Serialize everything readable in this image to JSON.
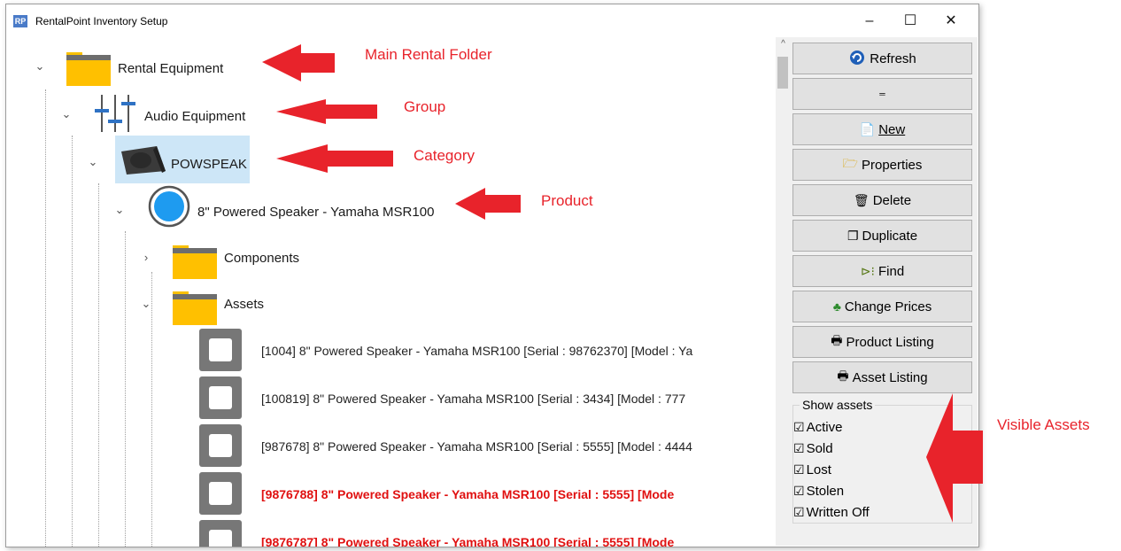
{
  "window": {
    "app_icon": "RP",
    "title": "RentalPoint Inventory Setup",
    "controls": {
      "minimize": "–",
      "maximize": "☐",
      "close": "✕"
    }
  },
  "tree": {
    "rental_equipment": "Rental Equipment",
    "audio_equipment": "Audio Equipment",
    "powspeak": "POWSPEAK",
    "product": "8\" Powered Speaker - Yamaha MSR100",
    "components": "Components",
    "assets": "Assets",
    "asset_rows": [
      {
        "text": "[1004] 8\" Powered Speaker - Yamaha MSR100    [Serial : 98762370]   [Model : Ya",
        "red": false
      },
      {
        "text": "[100819] 8\" Powered Speaker - Yamaha MSR100    [Serial : 3434]   [Model : 777",
        "red": false
      },
      {
        "text": "[987678] 8\" Powered Speaker - Yamaha MSR100    [Serial : 5555]   [Model : 4444",
        "red": false
      },
      {
        "text": "[9876788] 8\" Powered Speaker - Yamaha MSR100    [Serial : 5555]    [Mode",
        "red": true
      },
      {
        "text": "[9876787] 8\" Powered Speaker - Yamaha MSR100    [Serial : 5555]    [Mode",
        "red": true
      }
    ]
  },
  "buttons": {
    "refresh": "Refresh",
    "collapse": "═",
    "new": "New",
    "properties": "Properties",
    "delete": "Delete",
    "duplicate": "Duplicate",
    "find": "Find",
    "change_prices": "Change Prices",
    "product_listing": "Product Listing",
    "asset_listing": "Asset Listing"
  },
  "show_assets": {
    "title": "Show assets",
    "options": [
      {
        "label": "Active",
        "checked": true
      },
      {
        "label": "Sold",
        "checked": true
      },
      {
        "label": "Lost",
        "checked": true
      },
      {
        "label": "Stolen",
        "checked": true
      },
      {
        "label": "Written Off",
        "checked": true
      }
    ]
  },
  "annotations": {
    "main_folder": "Main Rental Folder",
    "group": "Group",
    "category": "Category",
    "product": "Product",
    "visible_assets": "Visible Assets"
  },
  "colors": {
    "annotation_red": "#e8232b",
    "folder_yellow": "#ffc000",
    "selection_blue": "#cde6f7",
    "product_circle": "#1e9bf0"
  },
  "icons": {
    "refresh": "refresh-icon",
    "new": "new-document-icon",
    "properties": "folder-open-icon",
    "delete": "trash-icon",
    "duplicate": "duplicate-icon",
    "find": "find-icon",
    "change_prices": "prices-icon",
    "product_listing": "printer-icon",
    "asset_listing": "printer-icon"
  }
}
